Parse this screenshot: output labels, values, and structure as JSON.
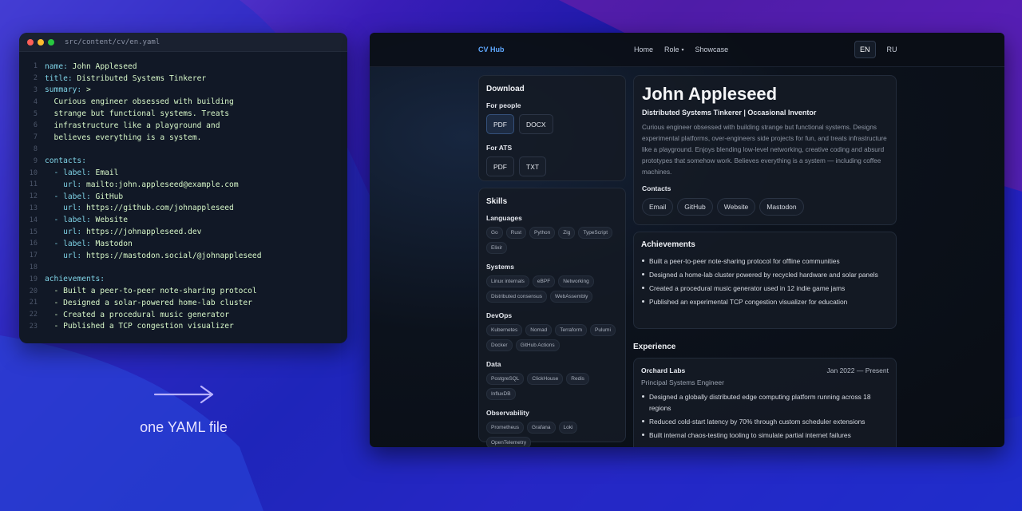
{
  "editor": {
    "filename": "src/content/cv/en.yaml",
    "traffic_colors": [
      "#ff5f57",
      "#febc2e",
      "#28c840"
    ],
    "lines": [
      {
        "n": "1",
        "key": "name:",
        "rest": " John Appleseed"
      },
      {
        "n": "2",
        "key": "title:",
        "rest": " Distributed Systems Tinkerer"
      },
      {
        "n": "3",
        "key": "summary:",
        "rest": " >"
      },
      {
        "n": "4",
        "key": "",
        "rest": "  Curious engineer obsessed with building"
      },
      {
        "n": "5",
        "key": "",
        "rest": "  strange but functional systems. Treats"
      },
      {
        "n": "6",
        "key": "",
        "rest": "  infrastructure like a playground and"
      },
      {
        "n": "7",
        "key": "",
        "rest": "  believes everything is a system."
      },
      {
        "n": "8",
        "key": "",
        "rest": ""
      },
      {
        "n": "9",
        "key": "contacts:",
        "rest": ""
      },
      {
        "n": "10",
        "key": "  - label:",
        "rest": " Email"
      },
      {
        "n": "11",
        "key": "    url:",
        "rest": " mailto:john.appleseed@example.com"
      },
      {
        "n": "12",
        "key": "  - label:",
        "rest": " GitHub"
      },
      {
        "n": "13",
        "key": "    url:",
        "rest": " https://github.com/johnappleseed"
      },
      {
        "n": "14",
        "key": "  - label:",
        "rest": " Website"
      },
      {
        "n": "15",
        "key": "    url:",
        "rest": " https://johnappleseed.dev"
      },
      {
        "n": "16",
        "key": "  - label:",
        "rest": " Mastodon"
      },
      {
        "n": "17",
        "key": "    url:",
        "rest": " https://mastodon.social/@johnappleseed"
      },
      {
        "n": "18",
        "key": "",
        "rest": ""
      },
      {
        "n": "19",
        "key": "achievements:",
        "rest": ""
      },
      {
        "n": "20",
        "key": "",
        "rest": "  - Built a peer-to-peer note-sharing protocol"
      },
      {
        "n": "21",
        "key": "",
        "rest": "  - Designed a solar-powered home-lab cluster"
      },
      {
        "n": "22",
        "key": "",
        "rest": "  - Created a procedural music generator"
      },
      {
        "n": "23",
        "key": "",
        "rest": "  - Published a TCP congestion visualizer"
      }
    ]
  },
  "caption": "one YAML file",
  "arrow_icon": "arrow-right-icon",
  "nav": {
    "brand": "CV Hub",
    "links": [
      "Home",
      "Role",
      "Showcase"
    ],
    "role_caret": "▾",
    "lang_active": "EN",
    "lang_other": "RU"
  },
  "download": {
    "title": "Download",
    "people_label": "For people",
    "people_buttons": [
      "PDF",
      "DOCX"
    ],
    "ats_label": "For ATS",
    "ats_buttons": [
      "PDF",
      "TXT"
    ]
  },
  "skills": {
    "title": "Skills",
    "groups": [
      {
        "name": "Languages",
        "items": [
          "Go",
          "Rust",
          "Python",
          "Zig",
          "TypeScript",
          "Elixir"
        ]
      },
      {
        "name": "Systems",
        "items": [
          "Linux internals",
          "eBPF",
          "Networking",
          "Distributed consensus",
          "WebAssembly"
        ]
      },
      {
        "name": "DevOps",
        "items": [
          "Kubernetes",
          "Nomad",
          "Terraform",
          "Pulumi",
          "Docker",
          "GitHub Actions"
        ]
      },
      {
        "name": "Data",
        "items": [
          "PostgreSQL",
          "ClickHouse",
          "Redis",
          "InfluxDB"
        ]
      },
      {
        "name": "Observability",
        "items": [
          "Prometheus",
          "Grafana",
          "Loki",
          "OpenTelemetry"
        ]
      }
    ]
  },
  "profile": {
    "name": "John Appleseed",
    "title": "Distributed Systems Tinkerer | Occasional Inventor",
    "summary": "Curious engineer obsessed with building strange but functional systems. Designs experimental platforms, over-engineers side projects for fun, and treats infrastructure like a playground. Enjoys blending low-level networking, creative coding and absurd prototypes that somehow work. Believes everything is a system — including coffee machines.",
    "contacts_label": "Contacts",
    "contacts": [
      "Email",
      "GitHub",
      "Website",
      "Mastodon"
    ]
  },
  "achievements": {
    "title": "Achievements",
    "items": [
      "Built a peer-to-peer note-sharing protocol for offline communities",
      "Designed a home-lab cluster powered by recycled hardware and solar panels",
      "Created a procedural music generator used in 12 indie game jams",
      "Published an experimental TCP congestion visualizer for education"
    ]
  },
  "experience": {
    "title": "Experience",
    "company": "Orchard Labs",
    "dates": "Jan 2022 — Present",
    "role": "Principal Systems Engineer",
    "items": [
      "Designed a globally distributed edge computing platform running across 18 regions",
      "Reduced cold-start latency by 70% through custom scheduler extensions",
      "Built internal chaos-testing tooling to simulate partial internet failures"
    ]
  }
}
